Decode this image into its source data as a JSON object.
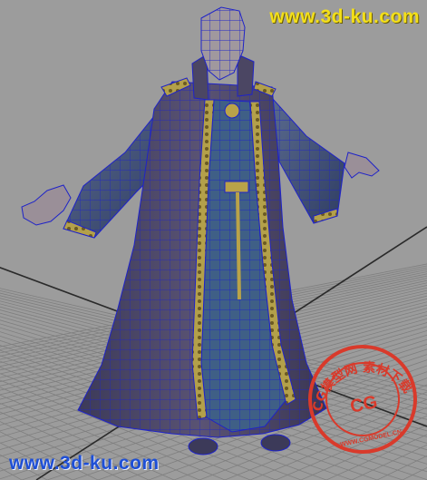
{
  "viewport": {
    "background": "#9c9c9c",
    "grid_color": "#7f7f7f",
    "grid_major_color": "#2a2a2a",
    "wireframe_color": "#1f23c8"
  },
  "watermarks": {
    "top_text": "www.3d-ku.com",
    "bottom_text": "www.3d-ku.com",
    "top_color": "#f3df1a",
    "bottom_color": "#1e4fd6"
  },
  "stamp": {
    "color": "#d93a2b",
    "arc_text": "CG模型网 素材下载",
    "center_text": "CG",
    "bottom_text": "WWW.CGMODEL.CN"
  },
  "model": {
    "robe_outer": "#4b4663",
    "robe_inner": "#3f5f86",
    "trim": "#b9a349",
    "skin": "#9a8f98"
  }
}
